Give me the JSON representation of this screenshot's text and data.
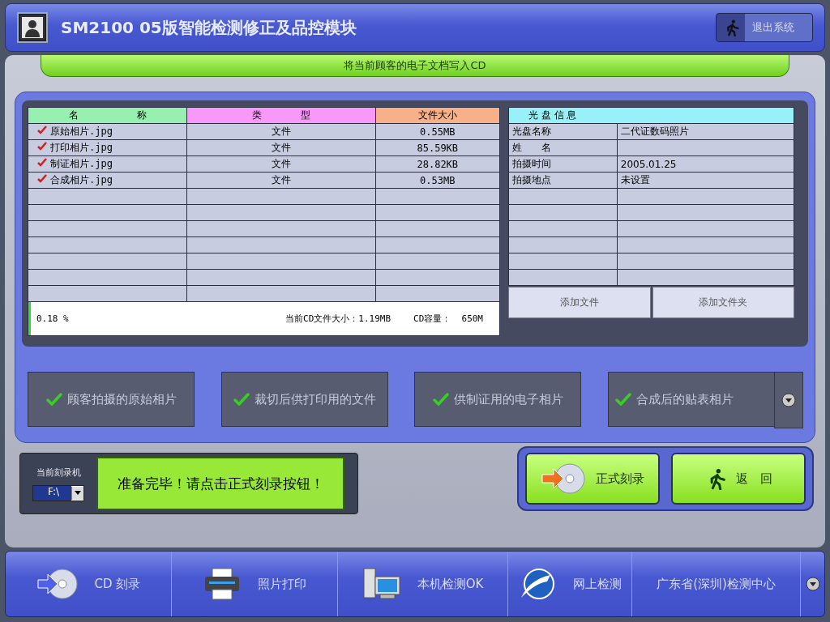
{
  "window": {
    "title": "SM2100 05版智能检测修正及品控模块"
  },
  "exit_button": "退出系统",
  "banner": "将当前顾客的电子文档写入CD",
  "file_table": {
    "columns": [
      "名　　　　　　称",
      "类　　　　型",
      "文件大小"
    ],
    "rows": [
      {
        "checked": true,
        "name": "原始相片.jpg",
        "type": "文件",
        "size": "0.55MB"
      },
      {
        "checked": true,
        "name": "打印相片.jpg",
        "type": "文件",
        "size": "85.59KB"
      },
      {
        "checked": true,
        "name": "制证相片.jpg",
        "type": "文件",
        "size": "28.82KB"
      },
      {
        "checked": true,
        "name": "合成相片.jpg",
        "type": "文件",
        "size": "0.53MB"
      }
    ],
    "footer": {
      "level": 0.005,
      "percent": "0.18 %",
      "current_size": "当前CD文件大小：1.19MB",
      "capacity": "CD容量：  650M"
    }
  },
  "disc_info": {
    "title": "光 盘 信 息",
    "rows": [
      {
        "label": "光盘名称",
        "value": "二代证数码照片"
      },
      {
        "label": "姓　　名",
        "value": ""
      },
      {
        "label": "拍摄时间",
        "value": "2005.01.25"
      },
      {
        "label": "拍摄地点",
        "value": "未设置"
      }
    ],
    "buttons": [
      "添加文件",
      "添加文件夹"
    ]
  },
  "categories": [
    {
      "label": "顾客拍摄的原始相片",
      "checked": true
    },
    {
      "label": "裁切后供打印用的文件",
      "checked": true
    },
    {
      "label": "供制证用的电子相片",
      "checked": true
    },
    {
      "label": "合成后的贴表相片",
      "checked": true
    }
  ],
  "recorder": {
    "label": "当前刻录机",
    "drive": "F:\\",
    "status": "准备完毕！请点击正式刻录按钮！"
  },
  "actions": [
    {
      "kind": "burn",
      "label": "正式刻录"
    },
    {
      "kind": "back",
      "label": "返　回"
    }
  ],
  "nav": [
    {
      "kind": "cd",
      "label": "CD 刻录"
    },
    {
      "kind": "printer",
      "label": "照片打印"
    },
    {
      "kind": "computer",
      "label": "本机检测OK"
    },
    {
      "kind": "globe",
      "label": "网上检测"
    },
    {
      "kind": "text",
      "label": "广东省(深圳)检测中心"
    }
  ]
}
